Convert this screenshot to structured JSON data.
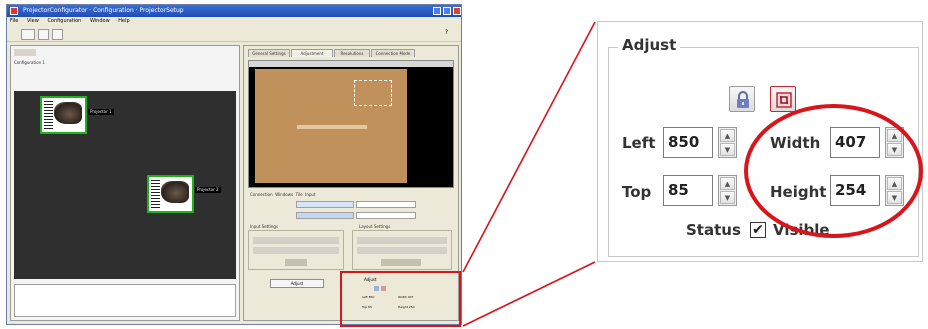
{
  "window": {
    "title": "ProjectorConfigurator · Configuration · ProjectorSetup",
    "menu": [
      "File",
      "View",
      "Configuration",
      "Window",
      "Help"
    ]
  },
  "left_panel": {
    "tree_label": "Configuration 1",
    "nodes": [
      "Projector 1",
      "Projector 2"
    ]
  },
  "right_panel": {
    "tabs": [
      "General Settings",
      "Adjustment",
      "Resolutions",
      "Connection Mode"
    ],
    "subtabs": [
      "Connection",
      "Windows",
      "Tile",
      "Input"
    ],
    "groups": [
      "Input Settings",
      "Layout Settings"
    ],
    "button": "Adjust"
  },
  "adjust": {
    "title": "Adjust",
    "left_label": "Left",
    "left_value": "850",
    "top_label": "Top",
    "top_value": "85",
    "width_label": "Width",
    "width_value": "407",
    "height_label": "Height",
    "height_value": "254",
    "status_label": "Status",
    "visible_label": "Visible",
    "visible_checked": true
  },
  "icons": [
    "lock-icon",
    "crop-icon",
    "spinner-up-icon",
    "spinner-down-icon",
    "checkbox-icon"
  ],
  "colors": {
    "highlight": "#d8151a",
    "node_border": "#1eb31e",
    "title_bar": "#1f4db3",
    "preview": "#c0915a"
  }
}
